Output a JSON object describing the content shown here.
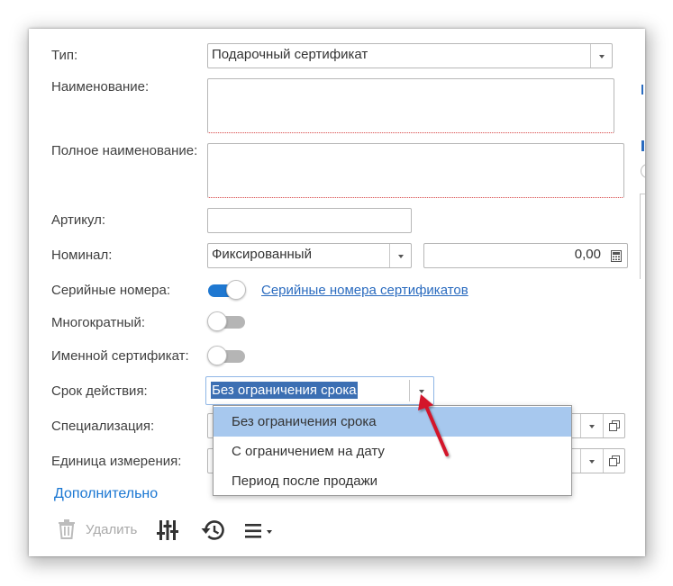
{
  "form": {
    "type": {
      "label": "Тип:",
      "value": "Подарочный сертификат"
    },
    "name": {
      "label": "Наименование:",
      "value": ""
    },
    "full_name": {
      "label": "Полное наименование:",
      "value": ""
    },
    "article": {
      "label": "Артикул:",
      "value": ""
    },
    "nominal": {
      "label": "Номинал:",
      "kind_value": "Фиксированный",
      "amount": "0,00"
    },
    "serial_numbers": {
      "label": "Серийные номера:",
      "enabled": true,
      "link": "Серийные номера сертификатов"
    },
    "multiple": {
      "label": "Многократный:",
      "enabled": false
    },
    "named": {
      "label": "Именной сертификат:",
      "enabled": false
    },
    "validity": {
      "label": "Срок действия:",
      "value": "Без ограничения срока"
    },
    "specialization": {
      "label": "Специализация:",
      "value": ""
    },
    "unit": {
      "label": "Единица измерения:",
      "value": ""
    },
    "additional_label": "Дополнительно"
  },
  "dropdown": {
    "options": [
      "Без ограничения срока",
      "С ограничением на дату",
      "Период после продажи"
    ],
    "selected_index": 0
  },
  "toolbar": {
    "delete_label": "Удалить"
  },
  "colors": {
    "accent": "#1976d2",
    "toggle_on": "#1f78d1",
    "toggle_off": "#b5b5b5",
    "selection": "#a7c8ee",
    "link": "#2a6bbf",
    "arrow": "#d3122b",
    "required_underline": "#d64040"
  }
}
